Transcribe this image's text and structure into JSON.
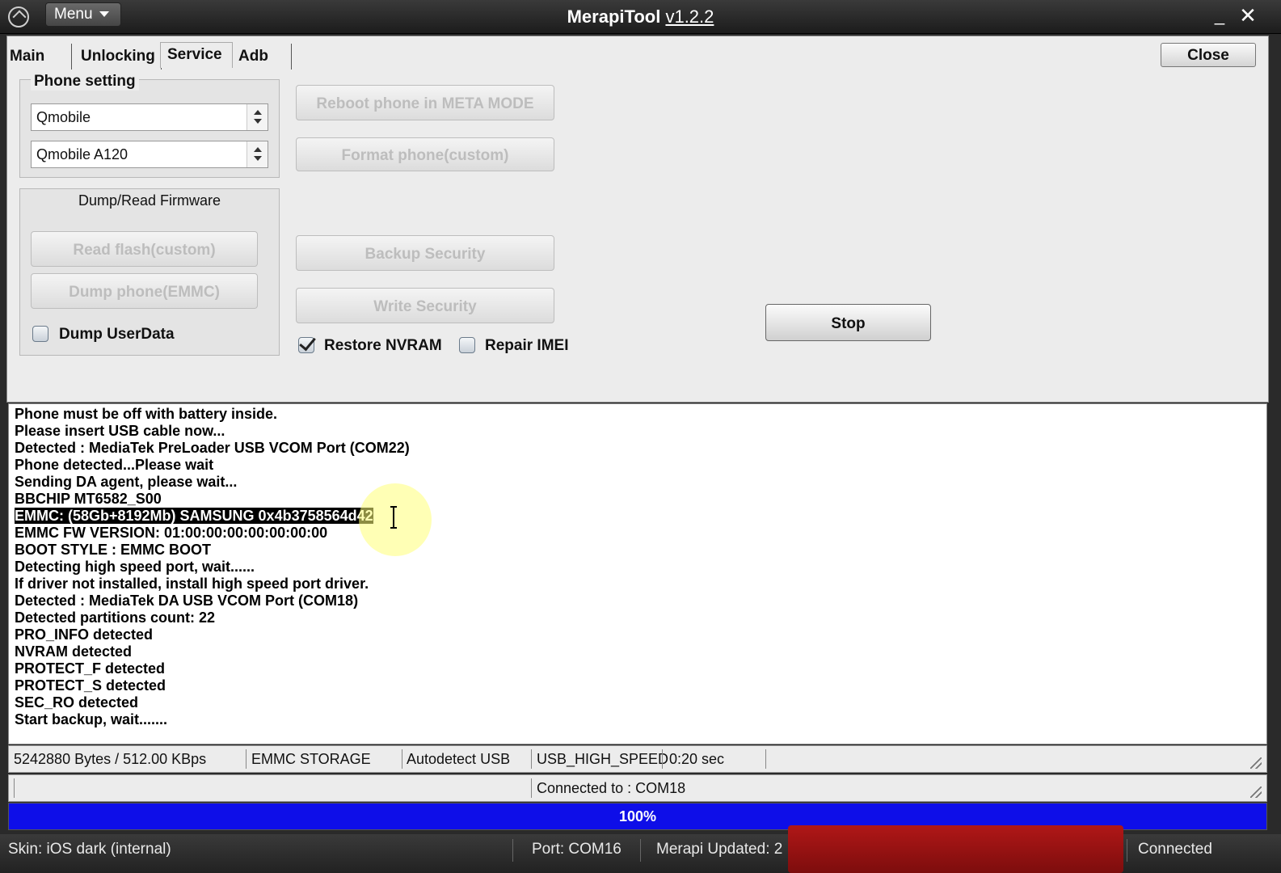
{
  "titlebar": {
    "menu_label": "Menu",
    "title": "MerapiTool",
    "version": "v1.2.2",
    "minimize_symbol": "_",
    "close_symbol": "✕"
  },
  "tabs": [
    {
      "label": "Main"
    },
    {
      "label": "Unlocking"
    },
    {
      "label": "Service"
    },
    {
      "label": "Adb"
    }
  ],
  "active_tab": "Service",
  "close_label": "Close",
  "phone_setting": {
    "title": "Phone setting",
    "brand": "Qmobile",
    "model": "Qmobile A120"
  },
  "dump_group": {
    "title": "Dump/Read Firmware",
    "read_flash_label": "Read flash(custom)",
    "dump_phone_label": "Dump phone(EMMC)",
    "dump_userdata_label": "Dump UserData",
    "dump_userdata_checked": false
  },
  "actions": {
    "reboot_meta_label": "Reboot phone in META MODE",
    "format_label": "Format phone(custom)",
    "backup_security_label": "Backup Security",
    "write_security_label": "Write Security",
    "restore_nvram_label": "Restore NVRAM",
    "restore_nvram_checked": true,
    "repair_imei_label": "Repair IMEI",
    "repair_imei_checked": false,
    "stop_label": "Stop"
  },
  "log": [
    "Phone must be off with battery inside.",
    "Please insert USB cable now...",
    "Detected : MediaTek PreLoader USB VCOM Port (COM22)",
    "Phone detected...Please wait",
    "Sending DA agent, please wait...",
    "BBCHIP MT6582_S00",
    "EMMC: (58Gb+8192Mb) SAMSUNG 0x4b3758564d42",
    "EMMC FW VERSION: 01:00:00:00:00:00:00:00",
    "BOOT STYLE : EMMC BOOT",
    "Detecting high speed port, wait......",
    "If driver not installed, install high speed port driver.",
    "Detected : MediaTek DA USB VCOM Port (COM18)",
    "Detected partitions count: 22",
    "PRO_INFO detected",
    "NVRAM detected",
    "PROTECT_F detected",
    "PROTECT_S detected",
    "SEC_RO detected",
    "Start backup, wait......."
  ],
  "status": {
    "transfer": "5242880 Bytes / 512.00 KBps",
    "storage": "EMMC STORAGE",
    "usb_mode": "Autodetect USB",
    "speed": "USB_HIGH_SPEED",
    "elapsed": "0:20 sec",
    "connected_to": "Connected to : COM18"
  },
  "progress": {
    "value": 1.0,
    "label": "100%",
    "color": "#0e0ee8"
  },
  "bottombar": {
    "skin": "Skin: iOS dark (internal)",
    "port": "Port: COM16",
    "updated": "Merapi Updated: 2",
    "connection": "Connected"
  }
}
